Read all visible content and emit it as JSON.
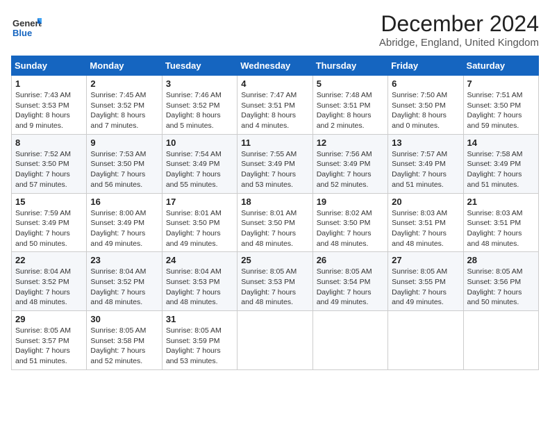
{
  "logo": {
    "general": "General",
    "blue": "Blue"
  },
  "title": "December 2024",
  "subtitle": "Abridge, England, United Kingdom",
  "days_of_week": [
    "Sunday",
    "Monday",
    "Tuesday",
    "Wednesday",
    "Thursday",
    "Friday",
    "Saturday"
  ],
  "weeks": [
    [
      {
        "day": "1",
        "sunrise": "7:43 AM",
        "sunset": "3:53 PM",
        "daylight": "8 hours and 9 minutes."
      },
      {
        "day": "2",
        "sunrise": "7:45 AM",
        "sunset": "3:52 PM",
        "daylight": "8 hours and 7 minutes."
      },
      {
        "day": "3",
        "sunrise": "7:46 AM",
        "sunset": "3:52 PM",
        "daylight": "8 hours and 5 minutes."
      },
      {
        "day": "4",
        "sunrise": "7:47 AM",
        "sunset": "3:51 PM",
        "daylight": "8 hours and 4 minutes."
      },
      {
        "day": "5",
        "sunrise": "7:48 AM",
        "sunset": "3:51 PM",
        "daylight": "8 hours and 2 minutes."
      },
      {
        "day": "6",
        "sunrise": "7:50 AM",
        "sunset": "3:50 PM",
        "daylight": "8 hours and 0 minutes."
      },
      {
        "day": "7",
        "sunrise": "7:51 AM",
        "sunset": "3:50 PM",
        "daylight": "7 hours and 59 minutes."
      }
    ],
    [
      {
        "day": "8",
        "sunrise": "7:52 AM",
        "sunset": "3:50 PM",
        "daylight": "7 hours and 57 minutes."
      },
      {
        "day": "9",
        "sunrise": "7:53 AM",
        "sunset": "3:50 PM",
        "daylight": "7 hours and 56 minutes."
      },
      {
        "day": "10",
        "sunrise": "7:54 AM",
        "sunset": "3:49 PM",
        "daylight": "7 hours and 55 minutes."
      },
      {
        "day": "11",
        "sunrise": "7:55 AM",
        "sunset": "3:49 PM",
        "daylight": "7 hours and 53 minutes."
      },
      {
        "day": "12",
        "sunrise": "7:56 AM",
        "sunset": "3:49 PM",
        "daylight": "7 hours and 52 minutes."
      },
      {
        "day": "13",
        "sunrise": "7:57 AM",
        "sunset": "3:49 PM",
        "daylight": "7 hours and 51 minutes."
      },
      {
        "day": "14",
        "sunrise": "7:58 AM",
        "sunset": "3:49 PM",
        "daylight": "7 hours and 51 minutes."
      }
    ],
    [
      {
        "day": "15",
        "sunrise": "7:59 AM",
        "sunset": "3:49 PM",
        "daylight": "7 hours and 50 minutes."
      },
      {
        "day": "16",
        "sunrise": "8:00 AM",
        "sunset": "3:49 PM",
        "daylight": "7 hours and 49 minutes."
      },
      {
        "day": "17",
        "sunrise": "8:01 AM",
        "sunset": "3:50 PM",
        "daylight": "7 hours and 49 minutes."
      },
      {
        "day": "18",
        "sunrise": "8:01 AM",
        "sunset": "3:50 PM",
        "daylight": "7 hours and 48 minutes."
      },
      {
        "day": "19",
        "sunrise": "8:02 AM",
        "sunset": "3:50 PM",
        "daylight": "7 hours and 48 minutes."
      },
      {
        "day": "20",
        "sunrise": "8:03 AM",
        "sunset": "3:51 PM",
        "daylight": "7 hours and 48 minutes."
      },
      {
        "day": "21",
        "sunrise": "8:03 AM",
        "sunset": "3:51 PM",
        "daylight": "7 hours and 48 minutes."
      }
    ],
    [
      {
        "day": "22",
        "sunrise": "8:04 AM",
        "sunset": "3:52 PM",
        "daylight": "7 hours and 48 minutes."
      },
      {
        "day": "23",
        "sunrise": "8:04 AM",
        "sunset": "3:52 PM",
        "daylight": "7 hours and 48 minutes."
      },
      {
        "day": "24",
        "sunrise": "8:04 AM",
        "sunset": "3:53 PM",
        "daylight": "7 hours and 48 minutes."
      },
      {
        "day": "25",
        "sunrise": "8:05 AM",
        "sunset": "3:53 PM",
        "daylight": "7 hours and 48 minutes."
      },
      {
        "day": "26",
        "sunrise": "8:05 AM",
        "sunset": "3:54 PM",
        "daylight": "7 hours and 49 minutes."
      },
      {
        "day": "27",
        "sunrise": "8:05 AM",
        "sunset": "3:55 PM",
        "daylight": "7 hours and 49 minutes."
      },
      {
        "day": "28",
        "sunrise": "8:05 AM",
        "sunset": "3:56 PM",
        "daylight": "7 hours and 50 minutes."
      }
    ],
    [
      {
        "day": "29",
        "sunrise": "8:05 AM",
        "sunset": "3:57 PM",
        "daylight": "7 hours and 51 minutes."
      },
      {
        "day": "30",
        "sunrise": "8:05 AM",
        "sunset": "3:58 PM",
        "daylight": "7 hours and 52 minutes."
      },
      {
        "day": "31",
        "sunrise": "8:05 AM",
        "sunset": "3:59 PM",
        "daylight": "7 hours and 53 minutes."
      },
      null,
      null,
      null,
      null
    ]
  ]
}
